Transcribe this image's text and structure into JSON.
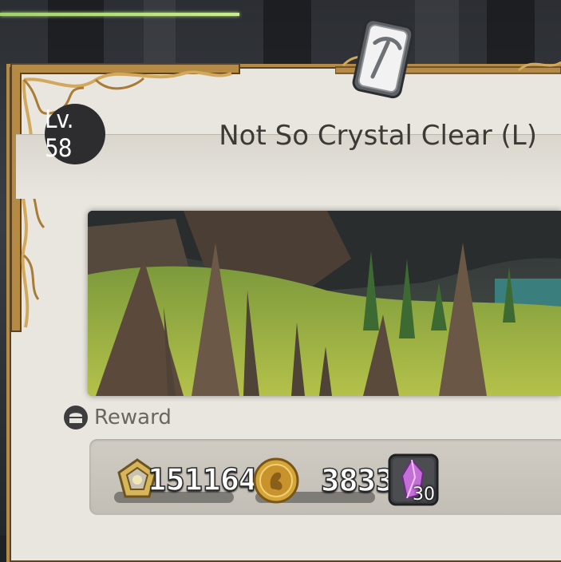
{
  "quest": {
    "level": "Lv. 58",
    "title": "Not So Crystal Clear (L)",
    "class_icon": "pickaxe-icon"
  },
  "rewards": {
    "label": "Reward",
    "items": [
      {
        "icon": "experience-icon",
        "amount": "1511640"
      },
      {
        "icon": "gil-coin-icon",
        "amount": "3833"
      },
      {
        "icon": "crystal-icon",
        "amount": "30"
      }
    ]
  },
  "colors": {
    "panel": "#e9e6df",
    "frame_gold": "#b58a45",
    "title_text": "#3d3a36",
    "badge": "#2d2d2f"
  }
}
